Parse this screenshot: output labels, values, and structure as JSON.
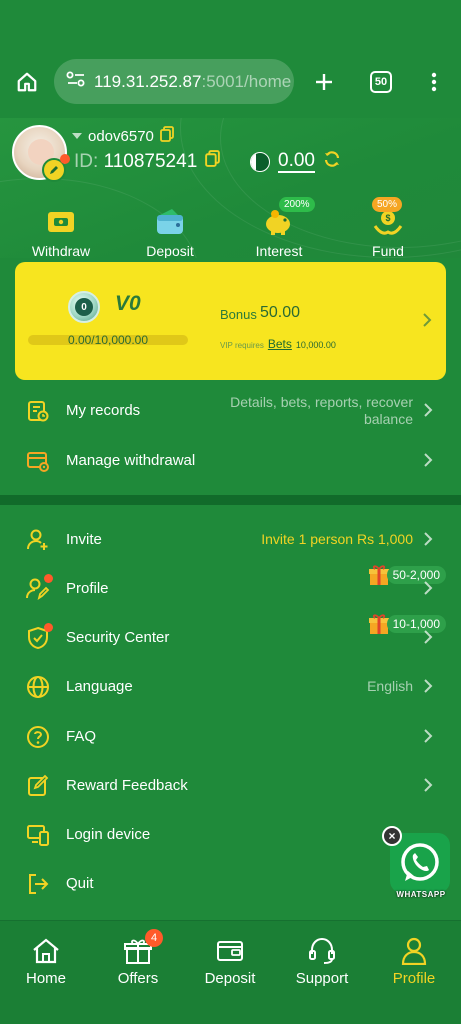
{
  "browser": {
    "url_main": "119.31.252.87",
    "url_rest": ":5001/home",
    "tab_count": "50"
  },
  "user": {
    "username": "odov6570",
    "id_label": "ID:",
    "id": "110875241",
    "balance": "0.00"
  },
  "quick_actions": [
    {
      "label": "Withdraw",
      "icon": "withdraw-icon"
    },
    {
      "label": "Deposit",
      "icon": "wallet-icon"
    },
    {
      "label": "Interest",
      "icon": "piggy-bank-icon",
      "badge": "200%"
    },
    {
      "label": "Fund",
      "icon": "fund-icon",
      "badge": "50%"
    }
  ],
  "vip": {
    "medal_level": "0",
    "level": "V0",
    "progress_text": "0.00/10,000.00",
    "progress_fraction": 0,
    "bonus_label": "Bonus",
    "bonus_value": "50.00",
    "requires_text": "VIP requires",
    "requires_link": "Bets",
    "requires_amount": "10,000.00"
  },
  "records": {
    "my_records": {
      "label": "My records",
      "hint": "Details, bets, reports, recover balance"
    },
    "manage_withdrawal": {
      "label": "Manage withdrawal"
    }
  },
  "menu": {
    "invite": {
      "label": "Invite",
      "hint": "Invite 1 person Rs 1,000"
    },
    "profile": {
      "label": "Profile",
      "gift": "50-2,000"
    },
    "security": {
      "label": "Security Center",
      "gift": "10-1,000"
    },
    "language": {
      "label": "Language",
      "hint": "English"
    },
    "faq": {
      "label": "FAQ"
    },
    "reward": {
      "label": "Reward Feedback"
    },
    "login_device": {
      "label": "Login device"
    },
    "quit": {
      "label": "Quit"
    }
  },
  "whatsapp": {
    "label": "WHATSAPP"
  },
  "bottom_nav": [
    {
      "label": "Home",
      "icon": "home-icon"
    },
    {
      "label": "Offers",
      "icon": "gift-icon",
      "badge": "4"
    },
    {
      "label": "Deposit",
      "icon": "wallet-icon"
    },
    {
      "label": "Support",
      "icon": "headset-icon"
    },
    {
      "label": "Profile",
      "icon": "person-icon",
      "active": true
    }
  ],
  "colors": {
    "background": "#1f8a3a",
    "accent_yellow": "#f1d324",
    "vip_card": "#f7e51f",
    "notification": "#ff5a2a"
  }
}
